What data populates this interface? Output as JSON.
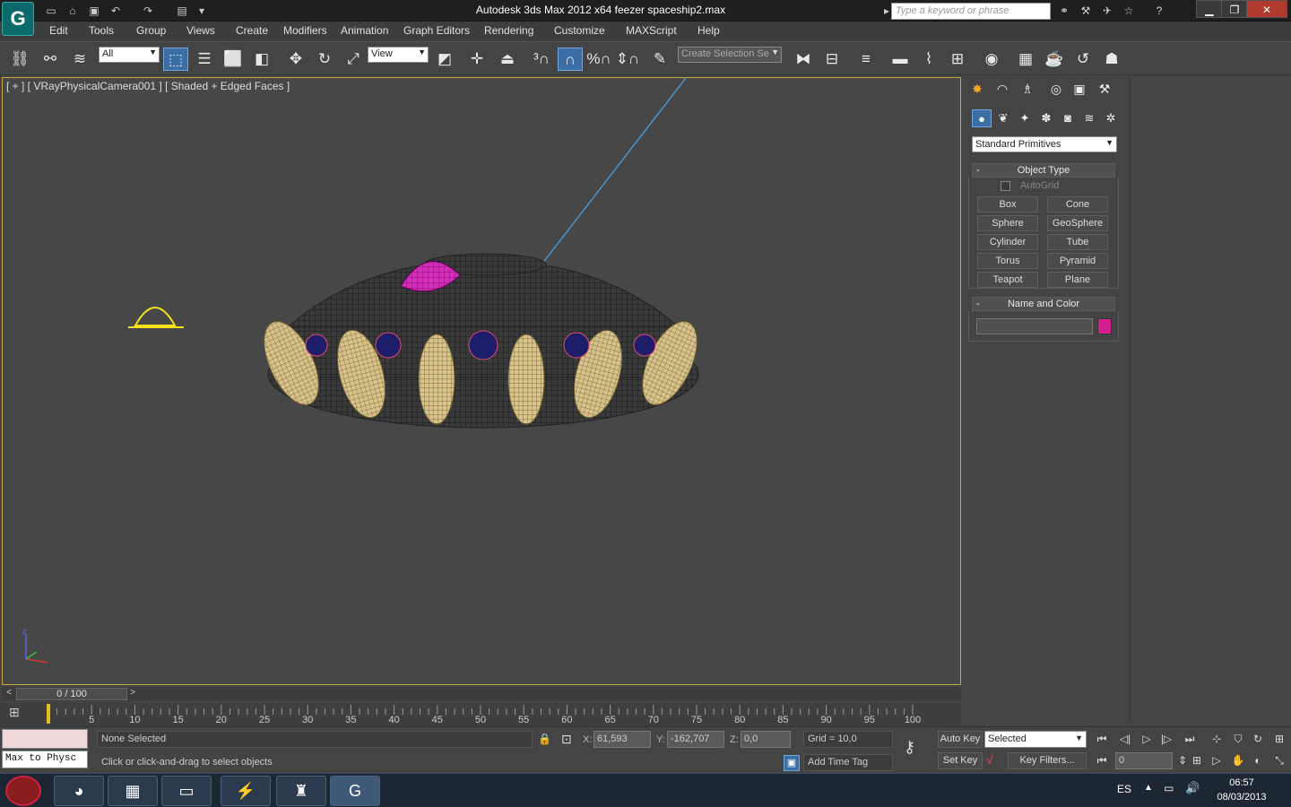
{
  "window": {
    "title": "Autodesk 3ds Max  2012 x64      feezer spaceship2.max",
    "search_placeholder": "Type a keyword or phrase",
    "minimize": "▁",
    "maximize": "❐",
    "close": "✕"
  },
  "menu": [
    "Edit",
    "Tools",
    "Group",
    "Views",
    "Create",
    "Modifiers",
    "Animation",
    "Graph Editors",
    "Rendering",
    "Customize",
    "MAXScript",
    "Help"
  ],
  "toolbar": {
    "selection_filter": "All",
    "reference_coord": "View",
    "named_selection_placeholder": "Create Selection Se"
  },
  "viewport": {
    "label": "[ + ] [ VRayPhysicalCamera001 ] [ Shaded + Edged Faces ]",
    "axis_label": "z"
  },
  "command_panel": {
    "category": "Standard Primitives",
    "object_type_title": "Object Type",
    "autogrid": "AutoGrid",
    "primitives": [
      "Box",
      "Cone",
      "Sphere",
      "GeoSphere",
      "Cylinder",
      "Tube",
      "Torus",
      "Pyramid",
      "Teapot",
      "Plane"
    ],
    "name_color_title": "Name and Color",
    "name_value": "",
    "object_color": "#d21e8e"
  },
  "timeline": {
    "frame_indicator": "0 / 100",
    "ticks": [
      "0",
      "5",
      "10",
      "15",
      "20",
      "25",
      "30",
      "35",
      "40",
      "45",
      "50",
      "55",
      "60",
      "65",
      "70",
      "75",
      "80",
      "85",
      "90",
      "95",
      "100"
    ]
  },
  "status": {
    "listener": "Max to Physc",
    "selection": "None Selected",
    "prompt": "Click or click-and-drag to select objects",
    "x_label": "X:",
    "x_value": "61,593",
    "y_label": "Y:",
    "y_value": "-162,707",
    "z_label": "Z:",
    "z_value": "0,0",
    "grid": "Grid = 10,0",
    "add_time_tag": "Add Time Tag",
    "auto_key": "Auto Key",
    "set_key": "Set Key",
    "key_mode": "Selected",
    "key_filters": "Key Filters...",
    "current_frame": "0"
  },
  "taskbar": {
    "language": "ES",
    "time": "06:57",
    "date": "08/03/2013"
  }
}
